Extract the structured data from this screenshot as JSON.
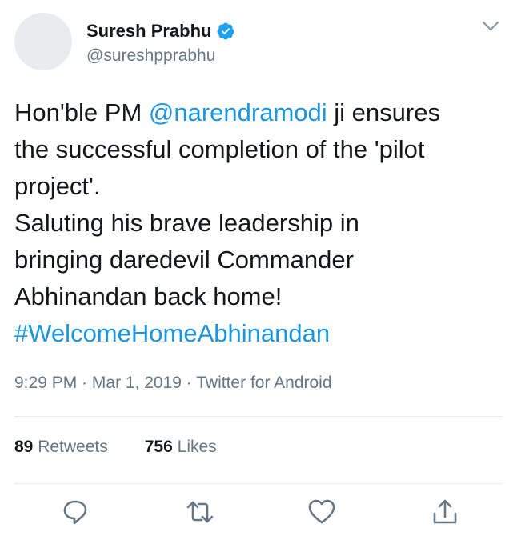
{
  "user": {
    "name": "Suresh Prabhu",
    "handle": "@sureshpprabhu"
  },
  "tweet": {
    "lines": [
      {
        "before": "Hon'ble PM ",
        "mention": "@narendramodi",
        "after": " ji ensures"
      },
      {
        "text": "the successful completion of the 'pilot"
      },
      {
        "text": "project'."
      },
      {
        "text": "Saluting his brave leadership in"
      },
      {
        "text": "bringing daredevil Commander"
      },
      {
        "text": "Abhinandan back home!"
      },
      {
        "hashtag": "#WelcomeHomeAbhinandan"
      }
    ]
  },
  "meta": {
    "time": "9:29 PM",
    "sep1": " · ",
    "date": "Mar 1, 2019",
    "sep2": " · ",
    "source": "Twitter for Android"
  },
  "stats": {
    "retweets_count": "89",
    "retweets_label": "Retweets",
    "likes_count": "756",
    "likes_label": "Likes"
  },
  "icons": {
    "reply": "reply-icon",
    "retweet": "retweet-icon",
    "like": "heart-icon",
    "share": "share-icon",
    "verified": "verified-badge-icon",
    "more": "chevron-down-icon"
  },
  "colors": {
    "link": "#1b95e0",
    "secondary": "#657786",
    "text": "#14171a",
    "verified": "#1da1f2"
  }
}
